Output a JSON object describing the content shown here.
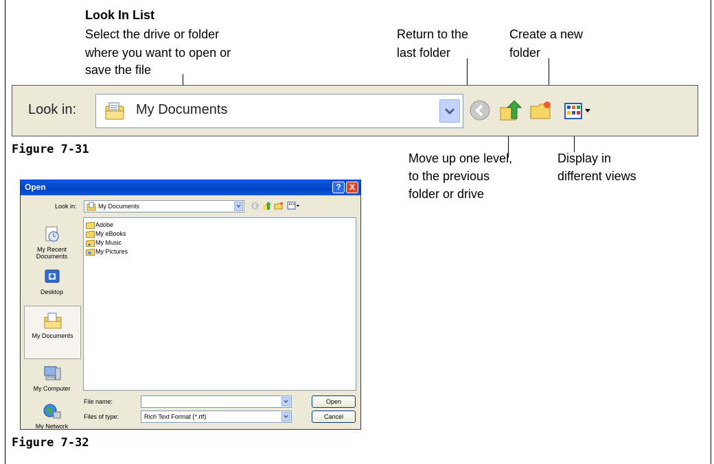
{
  "callouts": {
    "look_in_title": "Look In List",
    "look_in_line1": "Select the drive or folder",
    "look_in_line2": "where you want to open or",
    "look_in_line3": "save the file",
    "back_line1": "Return to the",
    "back_line2": "last folder",
    "new_folder_line1": "Create a new",
    "new_folder_line2": "folder",
    "up_line1": "Move up one level,",
    "up_line2": "to the previous",
    "up_line3": "folder or drive",
    "views_line1": "Display in",
    "views_line2": "different views"
  },
  "figure_31": {
    "label": "Figure 7-31",
    "look_in_label": "Look in:",
    "combo_value": "My Documents"
  },
  "figure_32": {
    "label": "Figure 7-32",
    "title": "Open",
    "help_button": "?",
    "close_button": "X",
    "look_in_label": "Look in:",
    "combo_value": "My Documents",
    "places": [
      {
        "label1": "My Recent",
        "label2": "Documents",
        "icon": "recent-documents-icon"
      },
      {
        "label1": "Desktop",
        "label2": "",
        "icon": "desktop-icon"
      },
      {
        "label1": "My Documents",
        "label2": "",
        "icon": "my-documents-icon"
      },
      {
        "label1": "My Computer",
        "label2": "",
        "icon": "my-computer-icon"
      },
      {
        "label1": "My Network",
        "label2": "",
        "icon": "my-network-icon"
      }
    ],
    "files": [
      "Adobe",
      "My eBooks",
      "My Music",
      "My Pictures"
    ],
    "file_name_label": "File name:",
    "file_name_value": "",
    "files_of_type_label": "Files of type:",
    "files_of_type_value": "Rich Text Format (*.rtf)",
    "open_button": "Open",
    "cancel_button": "Cancel"
  },
  "colors": {
    "title_bar": "#0a5ae0",
    "dialog_bg": "#ece9d8",
    "close_button": "#e0472a",
    "folder_yellow": "#f6d766"
  }
}
